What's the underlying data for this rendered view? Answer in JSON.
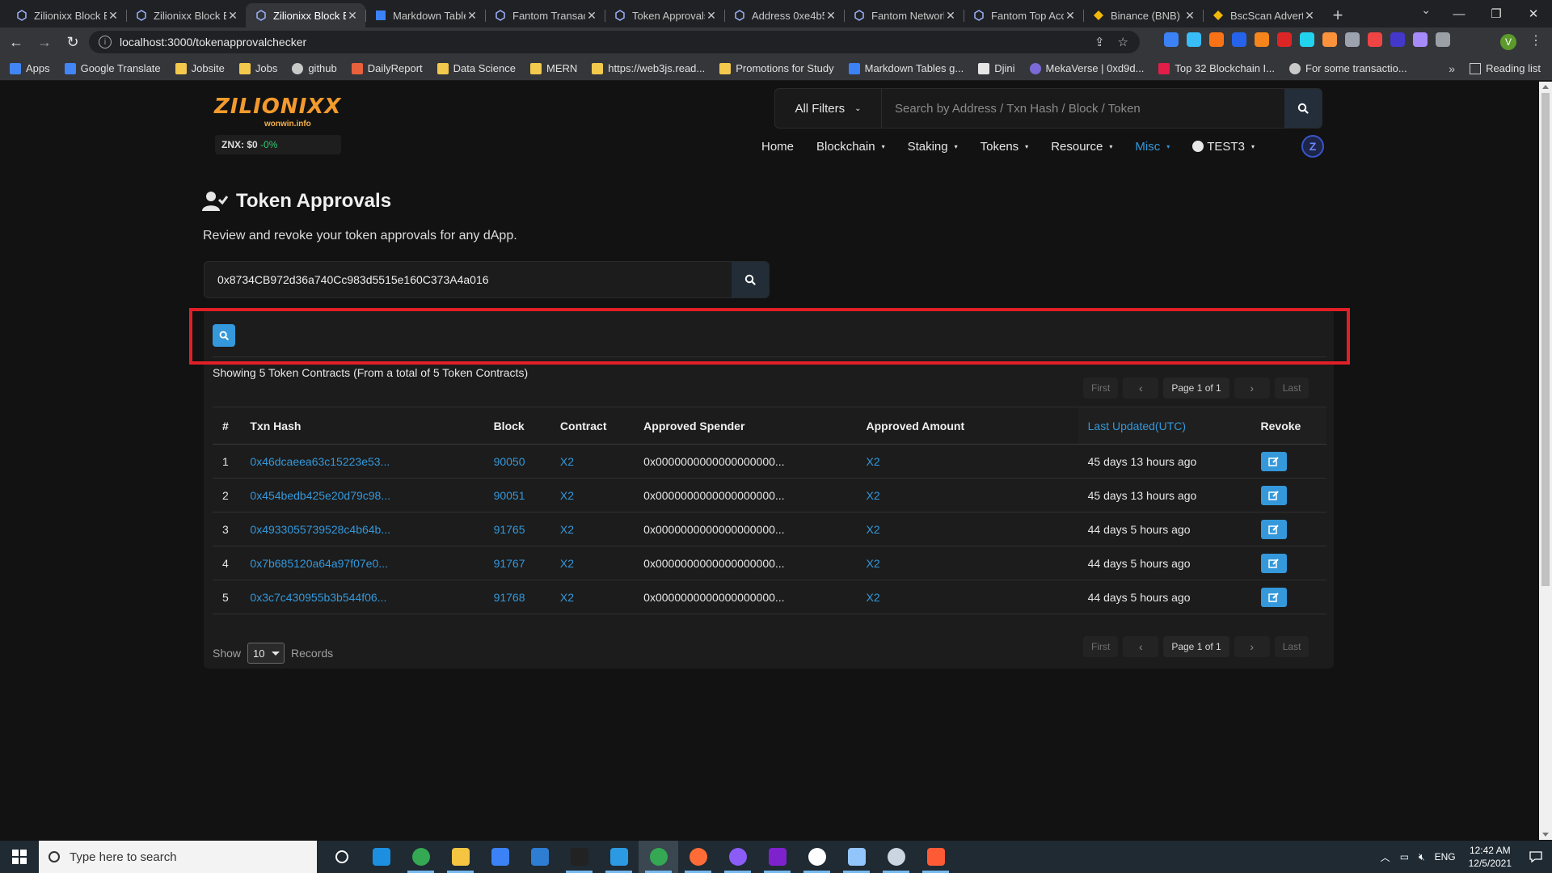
{
  "browser": {
    "tabs": [
      {
        "title": "Zilionixx Block E",
        "active": false
      },
      {
        "title": "Zilionixx Block E",
        "active": false
      },
      {
        "title": "Zilionixx Block E",
        "active": true
      },
      {
        "title": "Markdown Table",
        "active": false
      },
      {
        "title": "Fantom Transacti",
        "active": false
      },
      {
        "title": "Token Approvals",
        "active": false
      },
      {
        "title": "Address 0xe4b5",
        "active": false
      },
      {
        "title": "Fantom Network",
        "active": false
      },
      {
        "title": "Fantom Top Acc",
        "active": false
      },
      {
        "title": "Binance (BNB) E",
        "active": false
      },
      {
        "title": "BscScan Adverti",
        "active": false
      }
    ],
    "url": "localhost:3000/tokenapprovalchecker",
    "profile_initial": "V",
    "bookmarks": [
      {
        "label": "Apps",
        "kind": "apps"
      },
      {
        "label": "Google Translate",
        "kind": "translate"
      },
      {
        "label": "Jobsite",
        "kind": "folder"
      },
      {
        "label": "Jobs",
        "kind": "folder"
      },
      {
        "label": "github",
        "kind": "github"
      },
      {
        "label": "DailyReport",
        "kind": "report"
      },
      {
        "label": "Data Science",
        "kind": "folder"
      },
      {
        "label": "MERN",
        "kind": "folder"
      },
      {
        "label": "https://web3js.read...",
        "kind": "page"
      },
      {
        "label": "Promotions for Study",
        "kind": "folder"
      },
      {
        "label": "Markdown Tables g...",
        "kind": "table"
      },
      {
        "label": "Djini",
        "kind": "djini"
      },
      {
        "label": "MekaVerse | 0xd9d...",
        "kind": "meka"
      },
      {
        "label": "Top 32 Blockchain I...",
        "kind": "heart"
      },
      {
        "label": "For some transactio...",
        "kind": "github"
      }
    ],
    "more_glyph": "»",
    "reading_list": "Reading list"
  },
  "header": {
    "logo_text": "ZILIONIXX",
    "logo_sub": "wonwin.info",
    "price_label": "ZNX: $0",
    "price_change": "-0%",
    "filter_label": "All Filters",
    "search_placeholder": "Search by Address / Txn Hash / Block / Token",
    "nav": [
      {
        "label": "Home",
        "dropdown": false,
        "active": false
      },
      {
        "label": "Blockchain",
        "dropdown": true,
        "active": false
      },
      {
        "label": "Staking",
        "dropdown": true,
        "active": false
      },
      {
        "label": "Tokens",
        "dropdown": true,
        "active": false
      },
      {
        "label": "Resource",
        "dropdown": true,
        "active": false
      },
      {
        "label": "Misc",
        "dropdown": true,
        "active": true
      },
      {
        "label": "TEST3",
        "dropdown": true,
        "active": false
      }
    ],
    "badge_letter": "Z"
  },
  "main": {
    "title": "Token Approvals",
    "subtitle": "Review and revoke your token approvals for any dApp.",
    "address_value": "0x8734CB972d36a740Cc983d5515e160C373A4a016",
    "showing_text": "Showing 5 Token Contracts (From a total of 5 Token Contracts)",
    "pager": {
      "first": "First",
      "page": "Page 1 of 1",
      "last": "Last",
      "prev": "‹",
      "next": "›"
    },
    "columns": [
      "#",
      "Txn Hash",
      "Block",
      "Contract",
      "Approved Spender",
      "Approved Amount",
      "Last Updated(UTC)",
      "Revoke"
    ],
    "rows": [
      {
        "n": "1",
        "hash": "0x46dcaeea63c15223e53...",
        "block": "90050",
        "contract": "X2",
        "spender": "0x0000000000000000000...",
        "amount": "X2",
        "updated": "45 days 13 hours ago"
      },
      {
        "n": "2",
        "hash": "0x454bedb425e20d79c98...",
        "block": "90051",
        "contract": "X2",
        "spender": "0x0000000000000000000...",
        "amount": "X2",
        "updated": "45 days 13 hours ago"
      },
      {
        "n": "3",
        "hash": "0x4933055739528c4b64b...",
        "block": "91765",
        "contract": "X2",
        "spender": "0x0000000000000000000...",
        "amount": "X2",
        "updated": "44 days 5 hours ago"
      },
      {
        "n": "4",
        "hash": "0x7b685120a64a97f07e0...",
        "block": "91767",
        "contract": "X2",
        "spender": "0x0000000000000000000...",
        "amount": "X2",
        "updated": "44 days 5 hours ago"
      },
      {
        "n": "5",
        "hash": "0x3c7c430955b3b544f06...",
        "block": "91768",
        "contract": "X2",
        "spender": "0x0000000000000000000...",
        "amount": "X2",
        "updated": "44 days 5 hours ago"
      }
    ],
    "show_label": "Show",
    "page_size": "10",
    "records_label": "Records"
  },
  "taskbar": {
    "search_placeholder": "Type here to search",
    "language": "ENG",
    "time": "12:42 AM",
    "date": "12/5/2021",
    "apps": [
      "cortana",
      "edge",
      "chrome",
      "file-explorer",
      "store",
      "mail",
      "terminal",
      "vscode",
      "chrome-active",
      "postman",
      "github-desktop",
      "visual-studio",
      "mongodb-compass",
      "notepad",
      "paint",
      "sublime"
    ]
  },
  "colors": {
    "accent": "#3498db",
    "highlight": "#e21f26",
    "logo": "#f39a2d",
    "positive": "#2ecc71"
  }
}
